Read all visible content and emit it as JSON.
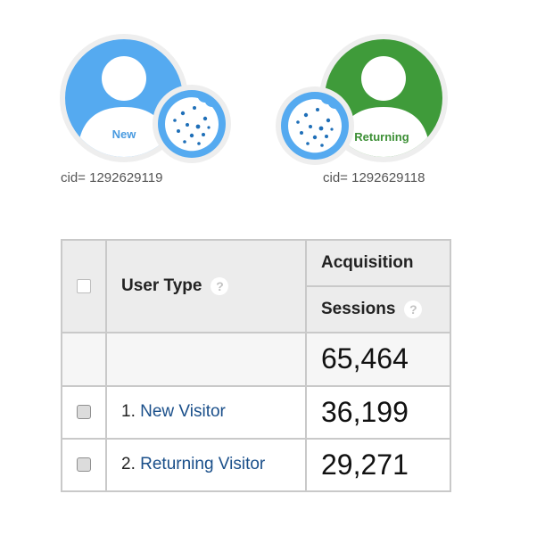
{
  "users": [
    {
      "label": "New",
      "cid": "cid= 1292629119",
      "color": "#55aaf0",
      "label_color": "#4a9be0"
    },
    {
      "label": "Returning",
      "cid": "cid= 1292629118",
      "color": "#3f9b3a",
      "label_color": "#3c8f35"
    }
  ],
  "cookie_color": "#55aaf0",
  "table": {
    "dimension_header": "User Type",
    "group_header": "Acquisition",
    "metric_header": "Sessions",
    "help_glyph": "?",
    "total": "65,464",
    "rows": [
      {
        "index": "1.",
        "label": "New Visitor",
        "value": "36,199"
      },
      {
        "index": "2.",
        "label": "Returning Visitor",
        "value": "29,271"
      }
    ]
  }
}
